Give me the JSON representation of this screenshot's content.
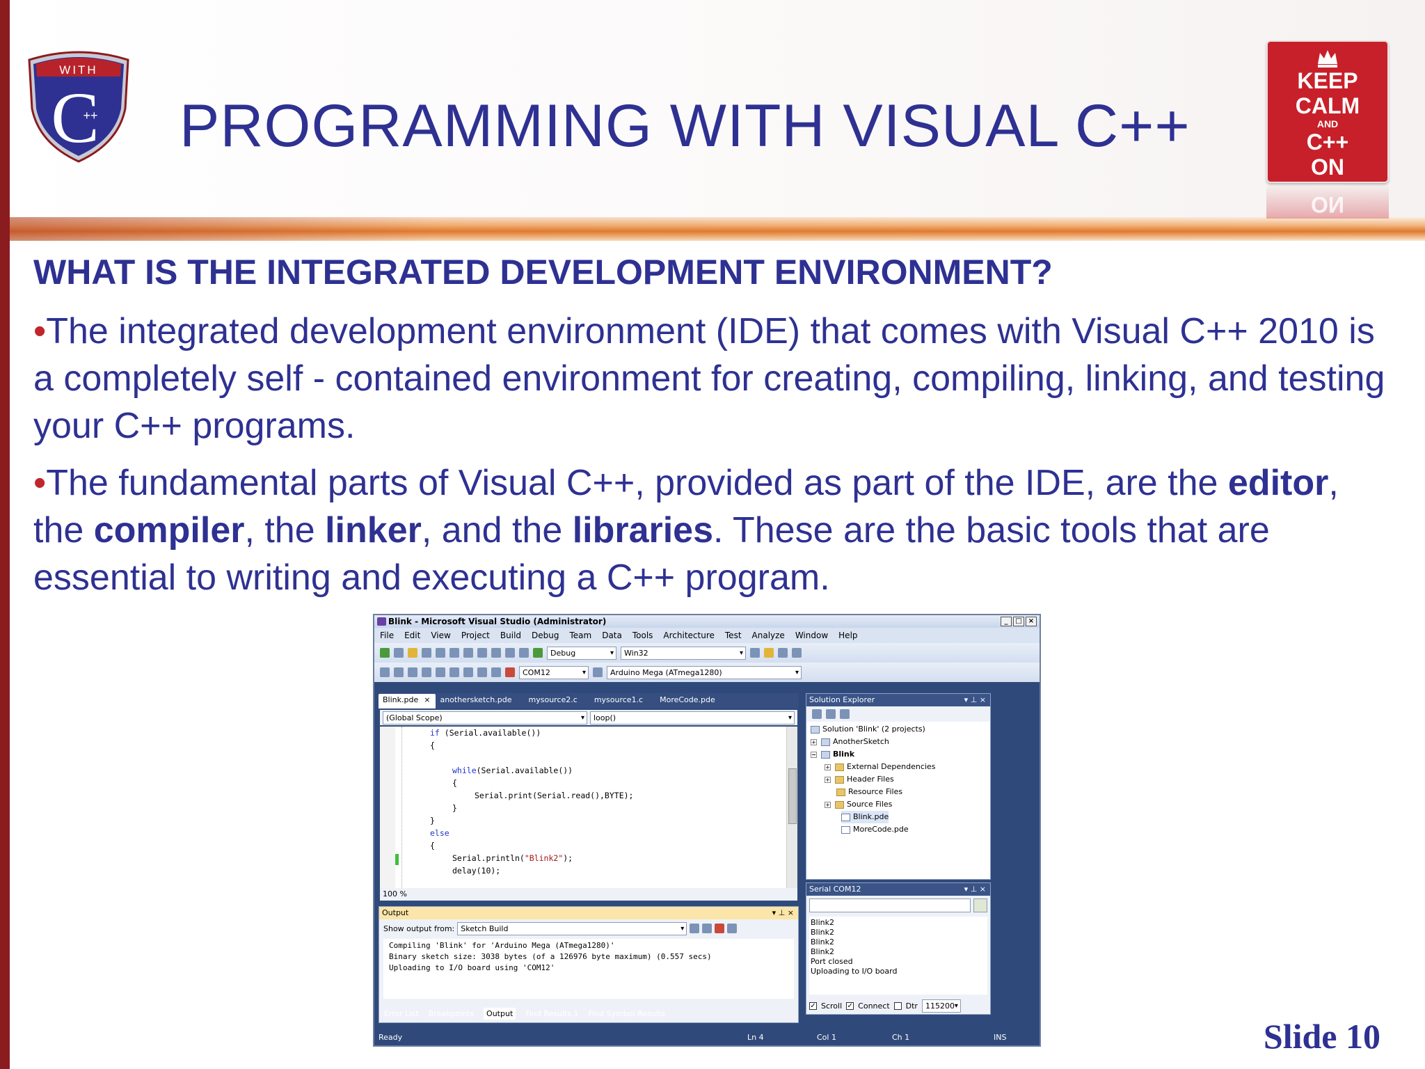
{
  "slide": {
    "title": "PROGRAMMING WITH VISUAL C++",
    "logo": {
      "top_text": "WITH",
      "letter": "C",
      "plus": "++"
    },
    "badge": {
      "line1": "KEEP",
      "line2": "CALM",
      "line3": "AND",
      "line4": "C++",
      "line5": "ON",
      "reflection": "ON"
    },
    "heading": "WHAT IS THE INTEGRATED DEVELOPMENT ENVIRONMENT?",
    "bullet_char": "•",
    "para1": "The integrated development environment (IDE) that comes with Visual C++ 2010 is a completely self - contained environment for creating, compiling, linking, and testing your C++ programs.",
    "para2": {
      "t1": "The fundamental parts of Visual C++, provided as part of the IDE, are the ",
      "b1": "editor",
      "t2": ", the ",
      "b2": "compiler",
      "t3": ", the ",
      "b3": "linker",
      "t4": ", and the ",
      "b4": "libraries",
      "t5": ". These are the basic tools that are essential to writing and executing a C++ program."
    },
    "slide_number": "Slide 10",
    "colors": {
      "text": "#2e3192",
      "bullet": "#c0272d",
      "left_bar": "#8a1b1f",
      "badge": "#c8202a"
    }
  },
  "ide": {
    "window_title": "Blink - Microsoft Visual Studio (Administrator)",
    "window_buttons": [
      "_",
      "□",
      "×"
    ],
    "menu": [
      "File",
      "Edit",
      "View",
      "Project",
      "Build",
      "Debug",
      "Team",
      "Data",
      "Tools",
      "Architecture",
      "Test",
      "Analyze",
      "Window",
      "Help"
    ],
    "toolbar": {
      "config": "Debug",
      "platform": "Win32",
      "port": "COM12",
      "board": "Arduino Mega (ATmega1280)"
    },
    "doc_tabs": [
      "Blink.pde",
      "anothersketch.pde",
      "mysource2.c",
      "mysource1.c",
      "MoreCode.pde"
    ],
    "tab_close": "×",
    "scope": {
      "left": "(Global Scope)",
      "right": "loop()"
    },
    "code": [
      {
        "kw": "if",
        "rest": " (Serial.available())"
      },
      {
        "kw": "",
        "rest": "{"
      },
      {
        "kw": "",
        "rest": ""
      },
      {
        "kw": "while",
        "rest": "(Serial.available())"
      },
      {
        "kw": "",
        "rest": "{"
      },
      {
        "kw": "",
        "rest": "Serial.print(Serial.read(),BYTE);"
      },
      {
        "kw": "",
        "rest": "}"
      },
      {
        "kw": "",
        "rest": "}"
      },
      {
        "kw": "else",
        "rest": ""
      },
      {
        "kw": "",
        "rest": "{"
      },
      {
        "kw": "",
        "rest": "Serial.println(",
        "str": "\"Blink2\"",
        "tail": ");"
      },
      {
        "kw": "",
        "rest": "delay(10);"
      }
    ],
    "zoom": "100 %",
    "output": {
      "title": "Output",
      "show_from_label": "Show output from:",
      "show_from_value": "Sketch Build",
      "lines": [
        "Compiling 'Blink' for 'Arduino Mega (ATmega1280)'",
        "Binary sketch size: 3038 bytes (of a 126976 byte maximum) (0.557 secs)",
        "Uploading to I/O board using 'COM12'"
      ]
    },
    "bottom_tabs": [
      "Error List",
      "Breakpoints",
      "Output",
      "Find Results 1",
      "Find Symbol Results"
    ],
    "solution_explorer": {
      "title": "Solution Explorer",
      "items": [
        "Solution 'Blink' (2 projects)",
        "AnotherSketch",
        "Blink",
        "External Dependencies",
        "Header Files",
        "Resource Files",
        "Source Files",
        "Blink.pde",
        "MoreCode.pde"
      ]
    },
    "serial": {
      "title": "Serial COM12",
      "lines": [
        "Blink2",
        "Blink2",
        "Blink2",
        "Blink2",
        "Port closed",
        "Uploading to I/O board"
      ],
      "scroll": "Scroll",
      "connect": "Connect",
      "dtr": "Dtr",
      "baud": "115200"
    },
    "status": {
      "ready": "Ready",
      "ln": "Ln 4",
      "col": "Col 1",
      "ch": "Ch 1",
      "mode": "INS"
    }
  }
}
